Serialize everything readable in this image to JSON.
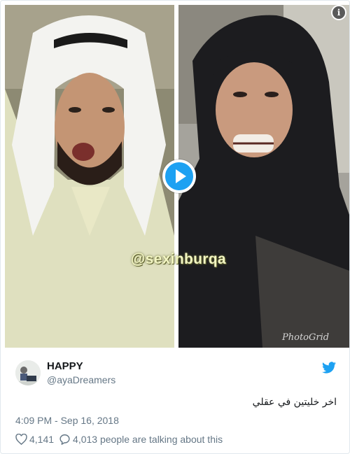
{
  "media": {
    "watermark": "@sexinburqa",
    "photogrid_mark": "PhotoGrid"
  },
  "author": {
    "display_name": "HAPPY",
    "handle": "@ayaDreamers"
  },
  "tweet": {
    "text": "اخر خليتين في عقلي",
    "timestamp": "4:09 PM - Sep 16, 2018"
  },
  "engagement": {
    "likes": "4,141",
    "talking": "4,013 people are talking about this"
  },
  "colors": {
    "brand_blue": "#1da1f2",
    "secondary_text": "#657786"
  },
  "icons": [
    "info-icon",
    "play-icon",
    "twitter-bird-icon",
    "heart-icon",
    "reply-icon"
  ]
}
